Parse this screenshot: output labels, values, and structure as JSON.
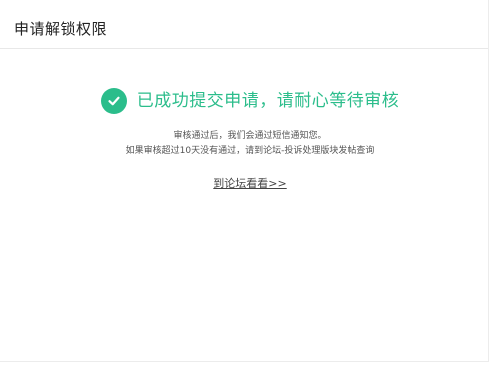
{
  "page": {
    "title": "申请解锁权限"
  },
  "status": {
    "icon": "check-circle-icon",
    "accent_color": "#2bbd8b",
    "message": "已成功提交申请，请耐心等待审核"
  },
  "info": {
    "line1": "审核通过后，我们会通过短信通知您。",
    "line2": "如果审核超过10天没有通过，请到论坛-投诉处理版块发帖查询"
  },
  "link": {
    "label": "到论坛看看>>"
  }
}
